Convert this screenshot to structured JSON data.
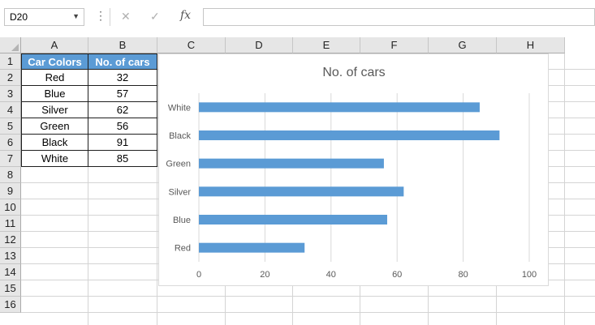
{
  "formula_bar": {
    "name_box": "D20",
    "fx_label": "fx",
    "formula": ""
  },
  "columns": [
    "A",
    "B",
    "C",
    "D",
    "E",
    "F",
    "G",
    "H"
  ],
  "rows": [
    "1",
    "2",
    "3",
    "4",
    "5",
    "6",
    "7",
    "8",
    "9",
    "10",
    "11",
    "12",
    "13",
    "14",
    "15",
    "16"
  ],
  "table": {
    "headers": [
      "Car Colors",
      "No. of cars"
    ],
    "rows": [
      [
        "Red",
        "32"
      ],
      [
        "Blue",
        "57"
      ],
      [
        "Silver",
        "62"
      ],
      [
        "Green",
        "56"
      ],
      [
        "Black",
        "91"
      ],
      [
        "White",
        "85"
      ]
    ]
  },
  "chart_data": {
    "type": "bar",
    "orientation": "horizontal",
    "title": "No. of cars",
    "categories": [
      "Red",
      "Blue",
      "Silver",
      "Green",
      "Black",
      "White"
    ],
    "values": [
      32,
      57,
      62,
      56,
      91,
      85
    ],
    "xlim": [
      0,
      100
    ],
    "xticks": [
      "0",
      "20",
      "40",
      "60",
      "80",
      "100"
    ],
    "grid": true,
    "legend": "none",
    "bar_color": "#5b9bd5"
  },
  "colors": {
    "header_fill": "#5b9bd5",
    "bar": "#5b9bd5",
    "gridline": "#d9d9d9"
  }
}
